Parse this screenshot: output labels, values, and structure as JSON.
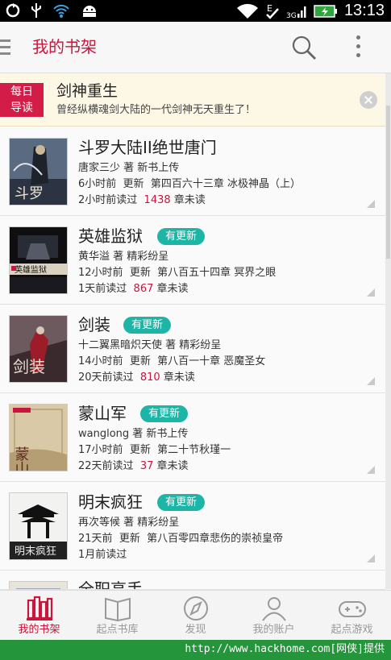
{
  "status_bar": {
    "time": "13:13",
    "icons": [
      "sync-icon",
      "usb-icon",
      "wifi-signal-icon",
      "android-icon",
      "wifi-icon",
      "data-e-icon",
      "cell-signal-icon",
      "battery-icon"
    ]
  },
  "app_bar": {
    "title": "我的书架",
    "icons": [
      "menu-icon",
      "search-icon",
      "more-icon"
    ]
  },
  "daily_banner": {
    "badge_line1": "每日",
    "badge_line2": "导读",
    "title": "剑神重生",
    "description": "曾经纵横魂剑大陆的一代剑神无天重生了！"
  },
  "books": [
    {
      "title": "斗罗大陆II绝世唐门",
      "has_update": false,
      "update_label": "",
      "author_line": "唐家三少 著   新书上传",
      "update_time": "6小时前",
      "update_word": "更新",
      "latest_chapter": "第四百六十三章 冰极神晶（上）",
      "read_time": "2小时前读过",
      "unread_count": "1438",
      "unread_suffix": "章未读",
      "cover_text": "斗罗"
    },
    {
      "title": "英雄监狱",
      "has_update": true,
      "update_label": "有更新",
      "author_line": "黄华溢 著   精彩纷呈",
      "update_time": "12小时前",
      "update_word": "更新",
      "latest_chapter": "第八百五十四章 冥界之眼",
      "read_time": "1天前读过",
      "unread_count": "867",
      "unread_suffix": "章未读",
      "cover_text": "英雄监狱"
    },
    {
      "title": "剑装",
      "has_update": true,
      "update_label": "有更新",
      "author_line": "十二翼黑暗炽天使 著   精彩纷呈",
      "update_time": "14小时前",
      "update_word": "更新",
      "latest_chapter": "第八百一十章 恶魔圣女",
      "read_time": "20天前读过",
      "unread_count": "810",
      "unread_suffix": "章未读",
      "cover_text": "剑装"
    },
    {
      "title": "蒙山军",
      "has_update": true,
      "update_label": "有更新",
      "author_line": "wanglong 著   新书上传",
      "update_time": "17小时前",
      "update_word": "更新",
      "latest_chapter": "第二十节秋瑾一",
      "read_time": "22天前读过",
      "unread_count": "37",
      "unread_suffix": "章未读",
      "cover_text": "蒙山军"
    },
    {
      "title": "明末疯狂",
      "has_update": true,
      "update_label": "有更新",
      "author_line": "再次等候 著   精彩纷呈",
      "update_time": "21天前",
      "update_word": "更新",
      "latest_chapter": "第八百零四章悲伤的崇祯皇帝",
      "read_time": "1月前读过",
      "unread_count": "",
      "unread_suffix": "",
      "cover_text": "明末疯狂"
    },
    {
      "title": "全职高手",
      "partial": true
    }
  ],
  "bottom_nav": [
    {
      "label": "我的书架",
      "icon": "bookshelf-icon",
      "active": true
    },
    {
      "label": "起点书库",
      "icon": "book-icon",
      "active": false
    },
    {
      "label": "发现",
      "icon": "compass-icon",
      "active": false
    },
    {
      "label": "我的账户",
      "icon": "user-icon",
      "active": false
    },
    {
      "label": "起点游戏",
      "icon": "gamepad-icon",
      "active": false
    }
  ],
  "footer": {
    "url_text": "http://www.hackhome.com[网侠]提供"
  },
  "colors": {
    "accent": "#c8163c",
    "update_tag": "#1db6a6",
    "footer_bg": "#24953a",
    "banner_bg": "#fdf8e6"
  }
}
